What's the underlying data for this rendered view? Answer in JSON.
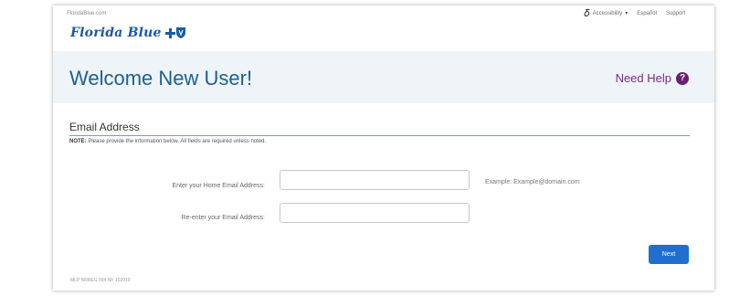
{
  "utility_bar": {
    "domain": "FloridaBlue.com",
    "accessibility_label": "Accessibility",
    "accessibility_icon": "accessibility-icon",
    "language_label": "Español",
    "support_label": "Support"
  },
  "brand": {
    "name": "Florida Blue",
    "logo_icon": "cross-shield-icon",
    "color": "#1a5aa8"
  },
  "banner": {
    "title": "Welcome New User!",
    "help_label": "Need Help",
    "help_icon": "question-circle-icon",
    "help_color": "#7b2a86"
  },
  "section": {
    "title": "Email Address",
    "note_prefix": "NOTE:",
    "note_text": "Please provide the information below. All fields are required unless noted."
  },
  "form": {
    "home_email_label": "Enter your Home Email Address:",
    "home_email_value": "",
    "reenter_email_label": "Re-enter your Email Address:",
    "reenter_email_value": "",
    "example_text": "Example: Example@domain.com",
    "next_label": "Next",
    "next_color": "#1f6fd1"
  },
  "footer": {
    "code": "MLP NRREG 004 NF 102019"
  }
}
